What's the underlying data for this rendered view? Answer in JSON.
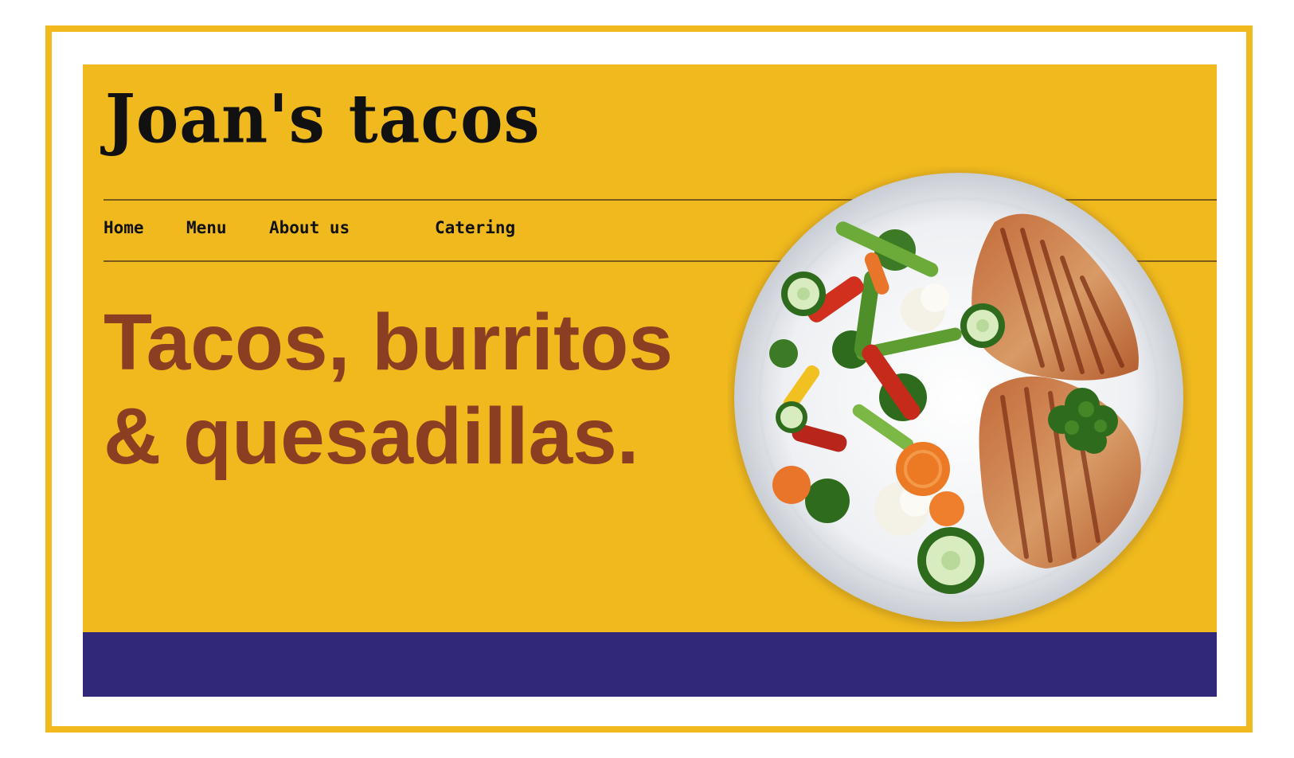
{
  "site": {
    "brand": "Joan's tacos",
    "nav": [
      {
        "label": "Home"
      },
      {
        "label": "Menu"
      },
      {
        "label": "About us"
      },
      {
        "label": "Catering"
      }
    ],
    "hero": {
      "headline_line1": "Tacos, burritos",
      "headline_line2": "& quesadillas.",
      "image": "grilled-fish-and-vegetables-plate"
    }
  },
  "colors": {
    "frame": "#F0BA1E",
    "background": "#F0BA1E",
    "headline": "#8B3E22",
    "footer": "#31287A",
    "text": "#111111"
  }
}
